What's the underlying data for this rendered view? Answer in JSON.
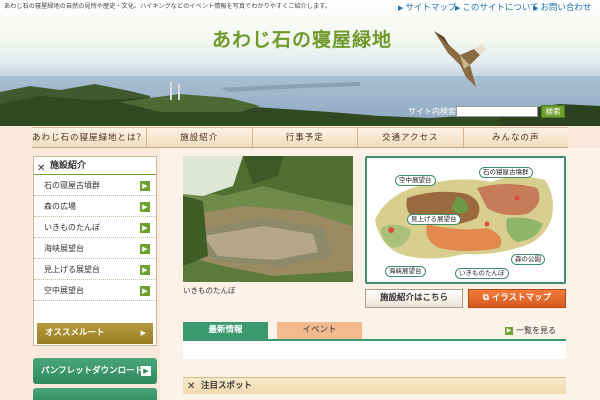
{
  "header": {
    "tagline": "あわじ石の寝屋緑地の自然の見所や歴史・文化、ハイキングなどのイベント情報を写真でわかりやすくご紹介します。",
    "links": [
      {
        "label": "サイトマップ"
      },
      {
        "label": "このサイトについて"
      },
      {
        "label": "お問い合わせ"
      }
    ],
    "title": "あわじ石の寝屋緑地",
    "search": {
      "label": "サイト内検索",
      "button": "検索",
      "value": ""
    }
  },
  "nav": {
    "items": [
      {
        "label": "あわじ石の寝屋緑地とは？"
      },
      {
        "label": "施設紹介"
      },
      {
        "label": "行事予定"
      },
      {
        "label": "交通アクセス"
      },
      {
        "label": "みんなの声"
      }
    ]
  },
  "sidebar": {
    "heading": "施設紹介",
    "items": [
      {
        "label": "石の寝屋古墳群"
      },
      {
        "label": "森の広場"
      },
      {
        "label": "いきものたんぼ"
      },
      {
        "label": "海峡展望台"
      },
      {
        "label": "見上げる展望台"
      },
      {
        "label": "空中展望台"
      }
    ],
    "recommend": "オススメルート",
    "pamphlet": "パンフレットダウンロード"
  },
  "main": {
    "photo_caption": "いきものたんぼ",
    "map_labels": [
      {
        "label": "石の寝屋古墳群"
      },
      {
        "label": "空中展望台"
      },
      {
        "label": "見上げる展望台"
      },
      {
        "label": "森の公園"
      },
      {
        "label": "海峡展望台"
      },
      {
        "label": "いきものたんぼ"
      }
    ],
    "facility_button": "施設紹介はこちら",
    "illust_button": "イラストマップ",
    "tabs": [
      {
        "label": "最新情報"
      },
      {
        "label": "イベント"
      }
    ],
    "more": "一覧を見る",
    "spot_heading": "注目スポット"
  },
  "colors": {
    "accent_green": "#6f9f2e",
    "teal": "#3a9a6e",
    "orange": "#e0642a",
    "background": "#fbe9dc"
  }
}
